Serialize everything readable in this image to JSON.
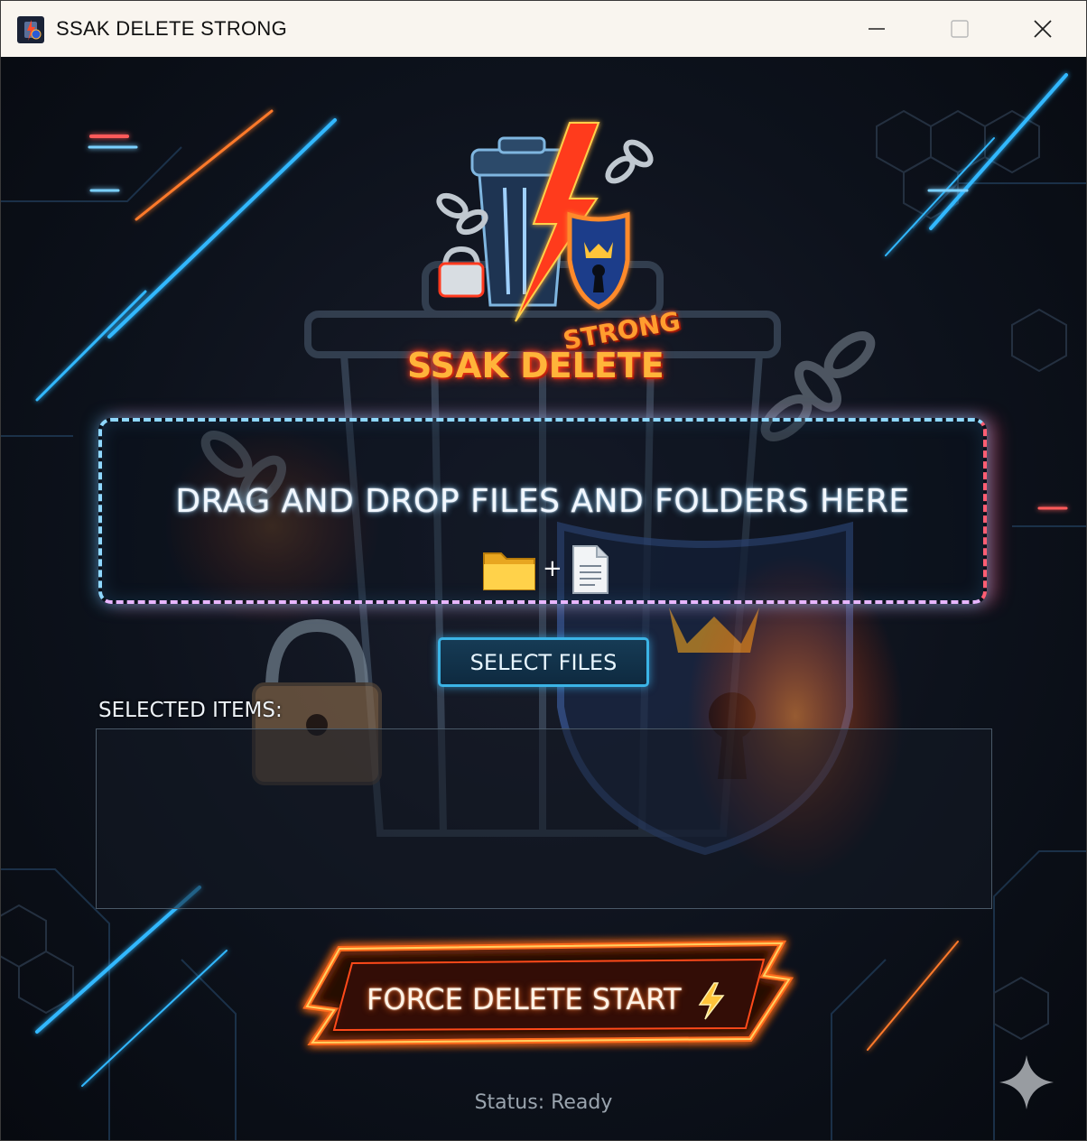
{
  "window": {
    "title": "SSAK DELETE STRONG"
  },
  "logo": {
    "title_main": "SSAK DELETE",
    "title_sub": "STRONG"
  },
  "drop_zone": {
    "text": "DRAG AND DROP FILES AND FOLDERS HERE",
    "plus": "+"
  },
  "buttons": {
    "select_files": "SELECT FILES",
    "force_delete": "FORCE DELETE START"
  },
  "selected": {
    "label": "SELECTED ITEMS:",
    "items": []
  },
  "status": {
    "text": "Status: Ready"
  },
  "icons": {
    "minimize": "minimize-icon",
    "maximize": "maximize-icon",
    "close": "close-icon",
    "folder": "folder-icon",
    "file": "file-icon",
    "lightning": "lightning-icon",
    "sparkle": "sparkle-icon"
  },
  "colors": {
    "titlebar": "#f9f5ef",
    "neon_blue": "#3bb4e6",
    "neon_red": "#ff5e73",
    "fire_orange": "#ff6a1a"
  }
}
